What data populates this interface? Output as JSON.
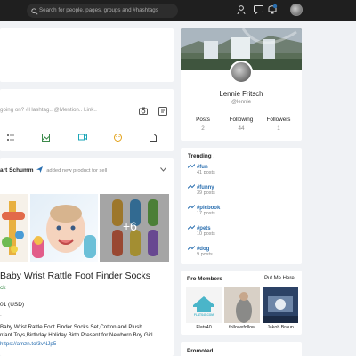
{
  "topbar": {
    "search_placeholder": "Search for people, pages, groups and #hashtags"
  },
  "composer": {
    "placeholder": "going on? #Hashtag.. @Mention.. Link.."
  },
  "post": {
    "author": "art Schumm",
    "action": "added new product for sell",
    "overlay_count": "+6",
    "title": "Baby Wrist Rattle Foot Finder Socks",
    "subtitle": "ck",
    "price": "01 (USD)",
    "description_line1": "Baby Wrist Rattle Foot Finder Socks Set,Cotton and Plush",
    "description_line2": "nfant Toys,Birthday Holiday Birth Present for Newborn Boy Girl",
    "description_link": "https://amzn.to/3vNJp5"
  },
  "profile": {
    "name": "Lennie Fritsch",
    "handle": "@lennie",
    "stats": [
      {
        "label": "Posts",
        "value": "2"
      },
      {
        "label": "Following",
        "value": "44"
      },
      {
        "label": "Followers",
        "value": "1"
      }
    ]
  },
  "trending": {
    "title": "Trending !",
    "items": [
      {
        "tag": "#fun",
        "count": "41 posts"
      },
      {
        "tag": "#funny",
        "count": "39 posts"
      },
      {
        "tag": "#picbook",
        "count": "17 posts"
      },
      {
        "tag": "#pets",
        "count": "10 posts"
      },
      {
        "tag": "#dog",
        "count": "9 posts"
      }
    ]
  },
  "pro_members": {
    "title": "Pro Members",
    "action": "Put Me Here",
    "members": [
      {
        "name": "Flats40",
        "logo_text": "FLATS40.COM"
      },
      {
        "name": "followxfollow"
      },
      {
        "name": "Jakob Braun"
      }
    ]
  },
  "promoted": {
    "title": "Promoted"
  },
  "colors": {
    "topbar": "#1f1f1f",
    "link": "#2a6fb0",
    "accent_green": "#3c8a4b"
  }
}
